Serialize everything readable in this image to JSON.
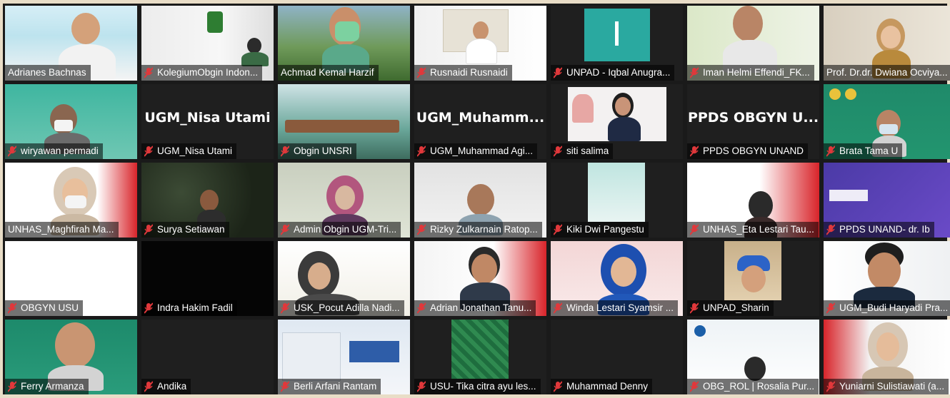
{
  "meeting": {
    "participants": [
      {
        "name": "Adrianes Bachnas",
        "muted": false,
        "active": true
      },
      {
        "name": "KolegiumObgin Indon...",
        "muted": true
      },
      {
        "name": "Achmad Kemal Harzif",
        "muted": false
      },
      {
        "name": "Rusnaidi Rusnaidi",
        "muted": true
      },
      {
        "name": "UNPAD - Iqbal Anugra...",
        "muted": true
      },
      {
        "name": "Iman Helmi Effendi_FK...",
        "muted": true
      },
      {
        "name": "Prof. Dr.dr. Dwiana Ocviya...",
        "muted": false
      },
      {
        "name": "wiryawan permadi",
        "muted": true
      },
      {
        "name": "UGM_Nisa Utami",
        "muted": true,
        "video_off": true,
        "display": "UGM_Nisa Utami"
      },
      {
        "name": "Obgin UNSRI",
        "muted": true
      },
      {
        "name": "UGM_Muhammad Agi...",
        "muted": true,
        "video_off": true,
        "display": "UGM_Muhamm..."
      },
      {
        "name": "siti salima",
        "muted": true
      },
      {
        "name": "PPDS OBGYN UNAND",
        "muted": true,
        "video_off": true,
        "display": "PPDS OBGYN U..."
      },
      {
        "name": "Brata Tama U",
        "muted": true
      },
      {
        "name": "UNHAS_Maghfirah Ma...",
        "muted": false
      },
      {
        "name": "Surya Setiawan",
        "muted": true
      },
      {
        "name": "Admin Obgin UGM-Tri...",
        "muted": true
      },
      {
        "name": "Rizky Zulkarnain Ratop...",
        "muted": true
      },
      {
        "name": "Kiki Dwi Pangestu",
        "muted": true
      },
      {
        "name": "UNHAS_Eta Lestari Tau...",
        "muted": true
      },
      {
        "name": "PPDS UNAND- dr. Ib",
        "muted": true
      },
      {
        "name": "OBGYN USU",
        "muted": true
      },
      {
        "name": "Indra Hakim Fadil",
        "muted": true
      },
      {
        "name": "USK_Pocut Adilla Nadi...",
        "muted": true
      },
      {
        "name": "Adrian Jonathan Tanu...",
        "muted": true
      },
      {
        "name": "Winda Lestari Syamsir ...",
        "muted": true
      },
      {
        "name": "UNPAD_Sharin",
        "muted": true
      },
      {
        "name": "UGM_Budi Haryadi Pra...",
        "muted": true
      },
      {
        "name": "Ferry Armanza",
        "muted": true
      },
      {
        "name": "Andika",
        "muted": true
      },
      {
        "name": "Berli Arfani Rantam",
        "muted": true
      },
      {
        "name": "USU- Tika citra ayu les...",
        "muted": true
      },
      {
        "name": "Muhammad Denny",
        "muted": true
      },
      {
        "name": "OBG_ROL | Rosalia Pur...",
        "muted": true
      },
      {
        "name": "Yuniarni Sulistiawati (a...",
        "muted": true
      }
    ]
  },
  "colors": {
    "muted_icon": "#e0383b",
    "active_border": "#f2e400",
    "tile_dark": "#1f1f1f"
  },
  "icons": {
    "muted": "mic-muted-icon"
  }
}
